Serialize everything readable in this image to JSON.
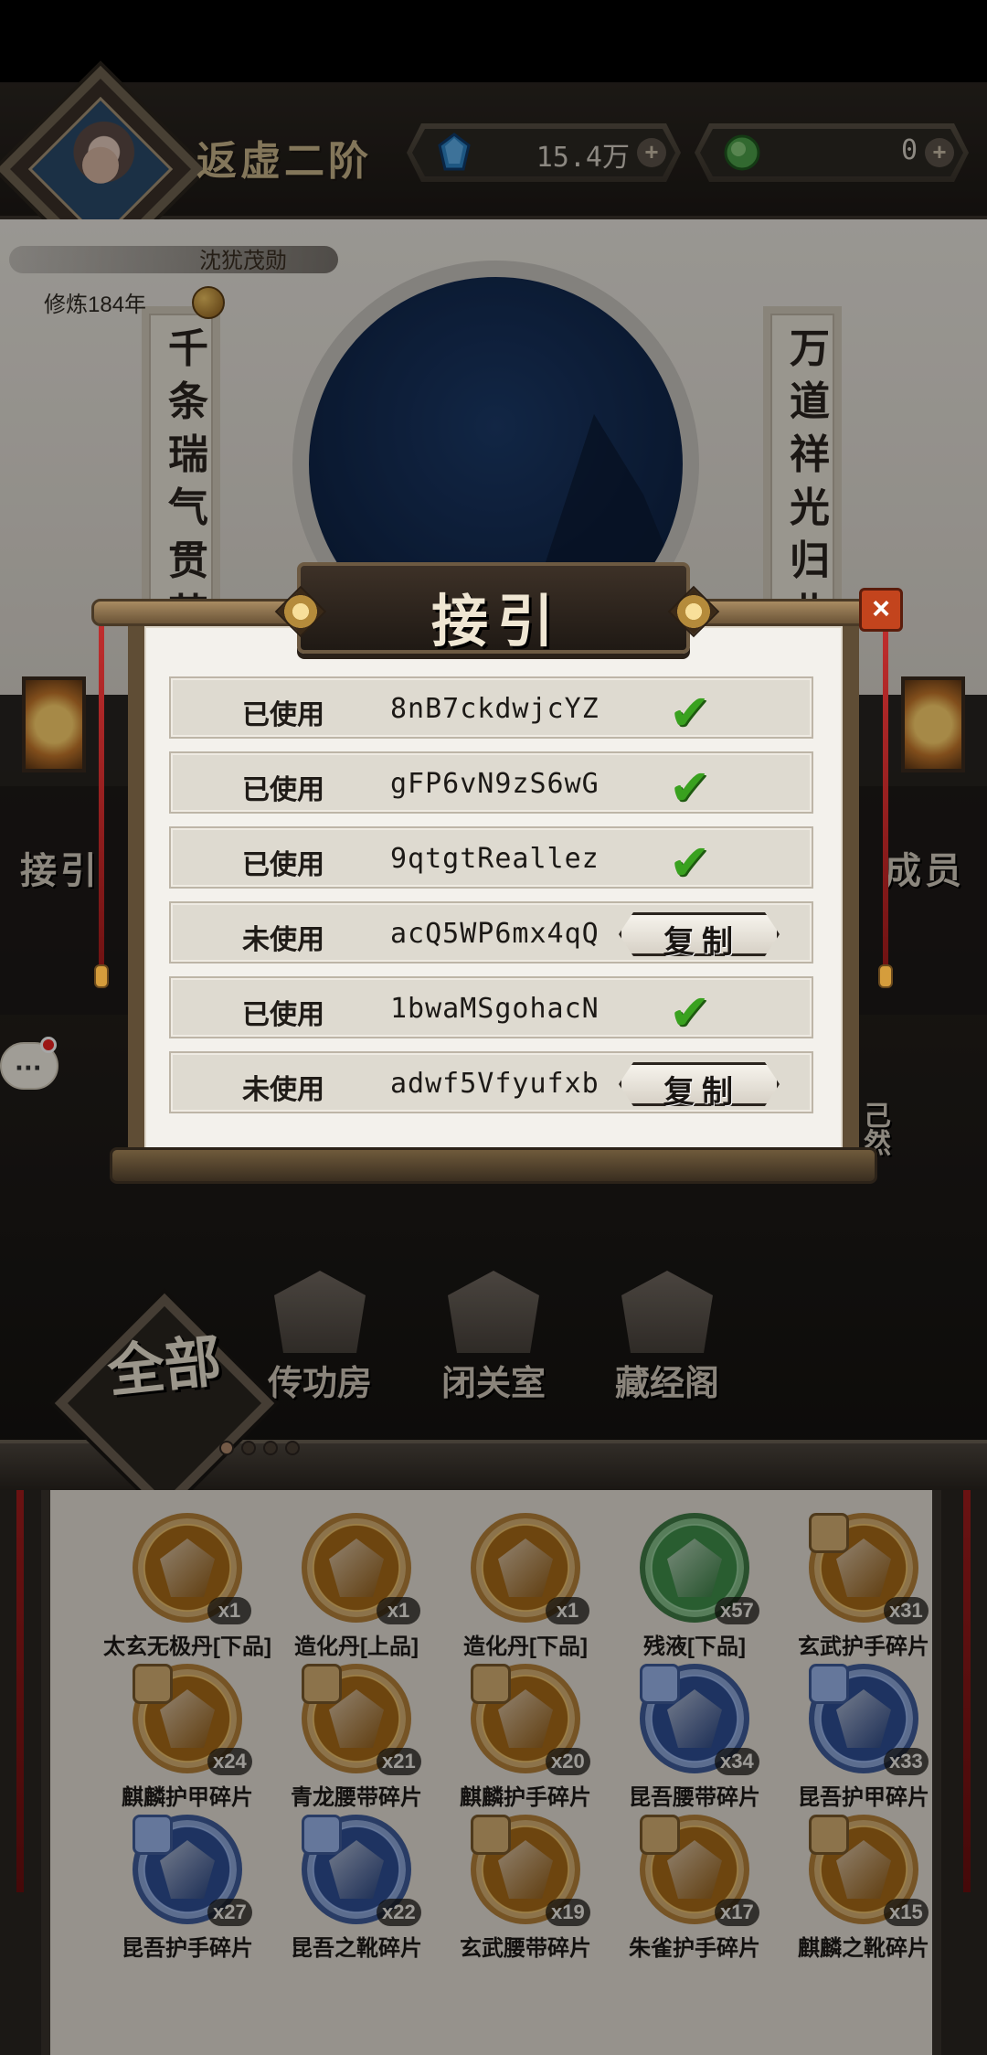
{
  "header": {
    "rank_title": "返虚二阶",
    "player_name": "沈犹茂勋",
    "cultivation_years": "修炼184年",
    "currencies": [
      {
        "name": "spirit-gem",
        "value": "15.4万"
      },
      {
        "name": "jade",
        "value": "0"
      }
    ]
  },
  "hall": {
    "couplets": [
      {
        "text": "千条瑞气贯苍"
      },
      {
        "text": "万道祥光归此"
      }
    ],
    "side_left_label": "接引",
    "side_right_label": "成员",
    "partial_text": [
      "己",
      "然"
    ]
  },
  "dock": {
    "nav": [
      {
        "label": "传功房"
      },
      {
        "label": "闭关室"
      },
      {
        "label": "藏经阁"
      }
    ],
    "all_label": "全部",
    "page_dots": 4
  },
  "modal": {
    "title": "接引",
    "rows": [
      {
        "status": "已使用",
        "code": "8nB7ckdwjcYZ",
        "action": "check"
      },
      {
        "status": "已使用",
        "code": "gFP6vN9zS6wG",
        "action": "check"
      },
      {
        "status": "已使用",
        "code": "9qtgtReallez",
        "action": "check"
      },
      {
        "status": "未使用",
        "code": "acQ5WP6mx4qQ",
        "action": "copy",
        "copy_label": "复制"
      },
      {
        "status": "已使用",
        "code": "1bwaMSgohacN",
        "action": "check"
      },
      {
        "status": "未使用",
        "code": "adwf5Vfyufxb",
        "action": "copy",
        "copy_label": "复制"
      }
    ]
  },
  "inventory": {
    "items": [
      {
        "name": "太玄无极丹[下品]",
        "count": "x1",
        "style": "gold",
        "icon": "pill-icon"
      },
      {
        "name": "造化丹[上品]",
        "count": "x1",
        "style": "gold",
        "icon": "scroll-icon"
      },
      {
        "name": "造化丹[下品]",
        "count": "x1",
        "style": "gold",
        "icon": "scroll-icon"
      },
      {
        "name": "残液[下品]",
        "count": "x57",
        "style": "green",
        "icon": "bottle-icon"
      },
      {
        "name": "玄武护手碎片",
        "count": "x31",
        "style": "gold-puzzle",
        "icon": "fragment-icon"
      },
      {
        "name": "麒麟护甲碎片",
        "count": "x24",
        "style": "gold-puzzle",
        "icon": "fragment-icon"
      },
      {
        "name": "青龙腰带碎片",
        "count": "x21",
        "style": "gold-puzzle",
        "icon": "fragment-icon"
      },
      {
        "name": "麒麟护手碎片",
        "count": "x20",
        "style": "gold-puzzle",
        "icon": "fragment-icon"
      },
      {
        "name": "昆吾腰带碎片",
        "count": "x34",
        "style": "blue-puzzle",
        "icon": "fragment-icon"
      },
      {
        "name": "昆吾护甲碎片",
        "count": "x33",
        "style": "blue-puzzle",
        "icon": "fragment-icon"
      },
      {
        "name": "昆吾护手碎片",
        "count": "x27",
        "style": "blue-puzzle",
        "icon": "fragment-icon"
      },
      {
        "name": "昆吾之靴碎片",
        "count": "x22",
        "style": "blue-puzzle",
        "icon": "fragment-icon"
      },
      {
        "name": "玄武腰带碎片",
        "count": "x19",
        "style": "gold-puzzle",
        "icon": "fragment-icon"
      },
      {
        "name": "朱雀护手碎片",
        "count": "x17",
        "style": "gold-puzzle",
        "icon": "fragment-icon"
      },
      {
        "name": "麒麟之靴碎片",
        "count": "x15",
        "style": "gold-puzzle",
        "icon": "fragment-icon"
      }
    ]
  },
  "colors": {
    "accent_gold": "#c9b58a",
    "check_green": "#39a11f",
    "close_red": "#c3441d"
  }
}
